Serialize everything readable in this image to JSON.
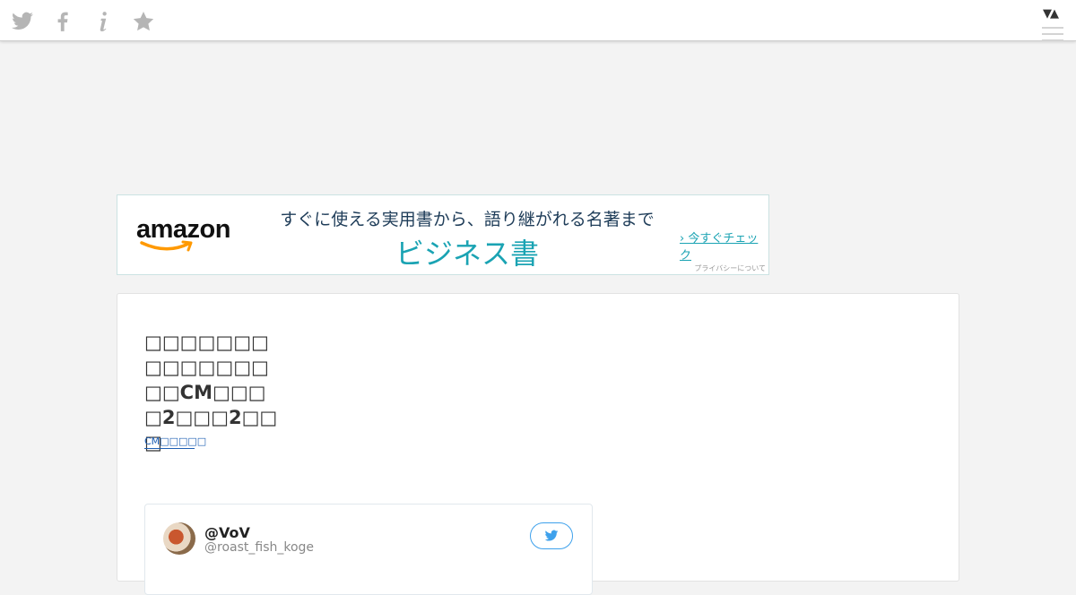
{
  "topbar": {
    "icons": [
      "twitter-icon",
      "facebook-icon",
      "info-icon",
      "star-icon"
    ],
    "toggle": "▼▲",
    "colors": {
      "icon": "#b5b5b5",
      "background": "#ffffff"
    }
  },
  "ad": {
    "brand": "amazon",
    "headline": "すぐに使える実用書から、語り継がれる名著まで",
    "big_text": "ビジネス書",
    "cta": "› 今すぐチェック",
    "privacy": "プライバシーについて",
    "colors": {
      "accent": "#1aa3b3",
      "headline": "#1f3d59",
      "brand_arrow": "#ff9900"
    }
  },
  "article": {
    "title": "□□□□□□□□□□□□□□□□CM□□□□2□□□2□□□",
    "tag": "CM□□□□□"
  },
  "tweet": {
    "name": "@VoV",
    "handle": "@roast_fish_koge",
    "accent": "#3ea1ec"
  }
}
